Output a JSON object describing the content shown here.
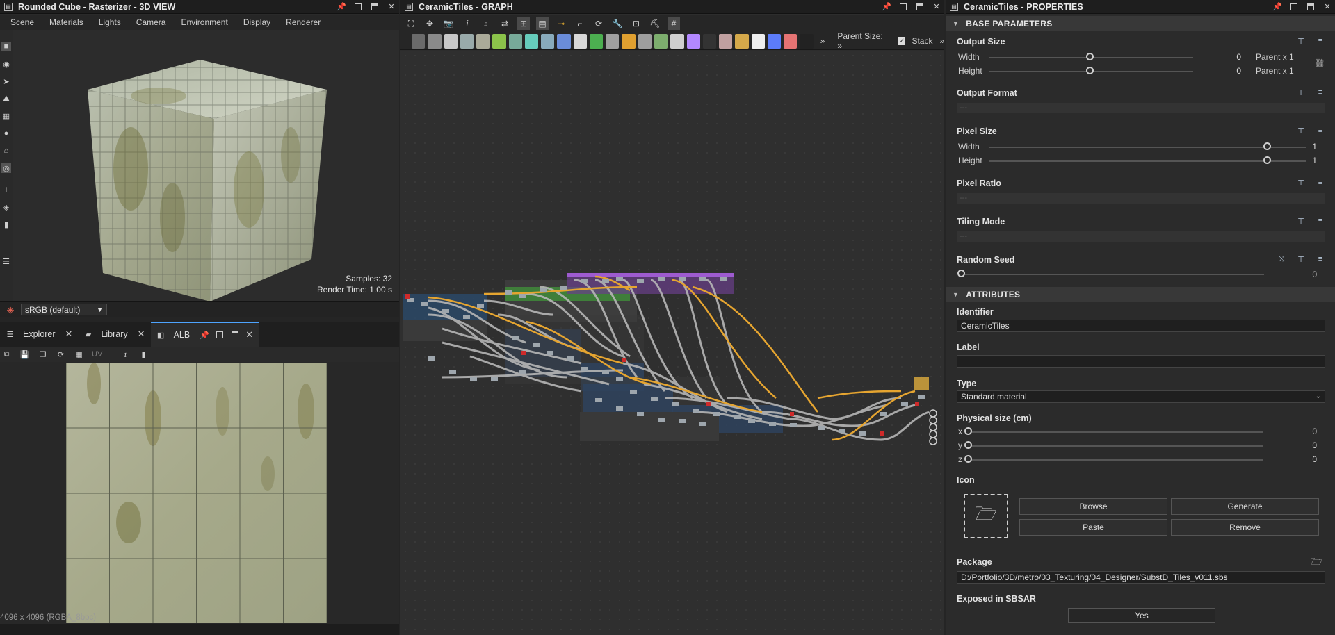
{
  "view3d": {
    "title": "Rounded Cube - Rasterizer - 3D VIEW",
    "menu": [
      "Scene",
      "Materials",
      "Lights",
      "Camera",
      "Environment",
      "Display",
      "Renderer"
    ],
    "samples": "Samples: 32",
    "render_time": "Render Time: 1.00 s",
    "colorspace": "sRGB (default)"
  },
  "view2d": {
    "tabs": [
      {
        "label": "Explorer",
        "icon": "tree-icon"
      },
      {
        "label": "Library",
        "icon": "folder-icon"
      },
      {
        "label": "ALB",
        "icon": "image-icon"
      }
    ],
    "uv_label": "UV",
    "resolution": "4096 x 4096 (RGBA_8bpc)"
  },
  "graph": {
    "title": "CeramicTiles - GRAPH",
    "parent_size_label": "Parent Size: »",
    "stack_label": "Stack",
    "more_label": "»",
    "node_colors": [
      "#6a6a6a",
      "#8a8a8a",
      "#c8c8c8",
      "#9aa",
      "#aa9",
      "#8bc34a",
      "#7a9",
      "#6cb",
      "#8ab",
      "#6a8cd9",
      "#d8d8d8",
      "#4caf50",
      "#a0a0a0",
      "#e0a030",
      "#9e9e9e",
      "#7dae6e",
      "#cfcfcf",
      "#b388ff",
      "#333",
      "#c0a0a0",
      "#d4a84a",
      "#eeeeee",
      "#5c7cfa",
      "#e57373",
      "#222"
    ]
  },
  "props": {
    "title": "CeramicTiles - PROPERTIES",
    "base_section": "BASE PARAMETERS",
    "output_size": {
      "title": "Output Size",
      "width_label": "Width",
      "width_value": "0",
      "width_mode": "Parent x 1",
      "height_label": "Height",
      "height_value": "0",
      "height_mode": "Parent x 1"
    },
    "output_format": {
      "title": "Output Format",
      "value": "---"
    },
    "pixel_size": {
      "title": "Pixel Size",
      "width_label": "Width",
      "width_value": "1",
      "height_label": "Height",
      "height_value": "1"
    },
    "pixel_ratio": {
      "title": "Pixel Ratio",
      "value": "---"
    },
    "tiling_mode": {
      "title": "Tiling Mode",
      "value": "---"
    },
    "random_seed": {
      "title": "Random Seed",
      "value": "0"
    },
    "attr_section": "ATTRIBUTES",
    "identifier": {
      "title": "Identifier",
      "value": "CeramicTiles"
    },
    "label": {
      "title": "Label",
      "value": ""
    },
    "type": {
      "title": "Type",
      "value": "Standard material"
    },
    "physical_size": {
      "title": "Physical size (cm)",
      "x_label": "x",
      "x_value": "0",
      "y_label": "y",
      "y_value": "0",
      "z_label": "z",
      "z_value": "0"
    },
    "icon": {
      "title": "Icon",
      "browse": "Browse",
      "generate": "Generate",
      "paste": "Paste",
      "remove": "Remove"
    },
    "package": {
      "title": "Package",
      "value": "D:/Portfolio/3D/metro/03_Texturing/04_Designer/SubstD_Tiles_v011.sbs"
    },
    "exposed": {
      "title": "Exposed in SBSAR",
      "value": "Yes"
    }
  }
}
